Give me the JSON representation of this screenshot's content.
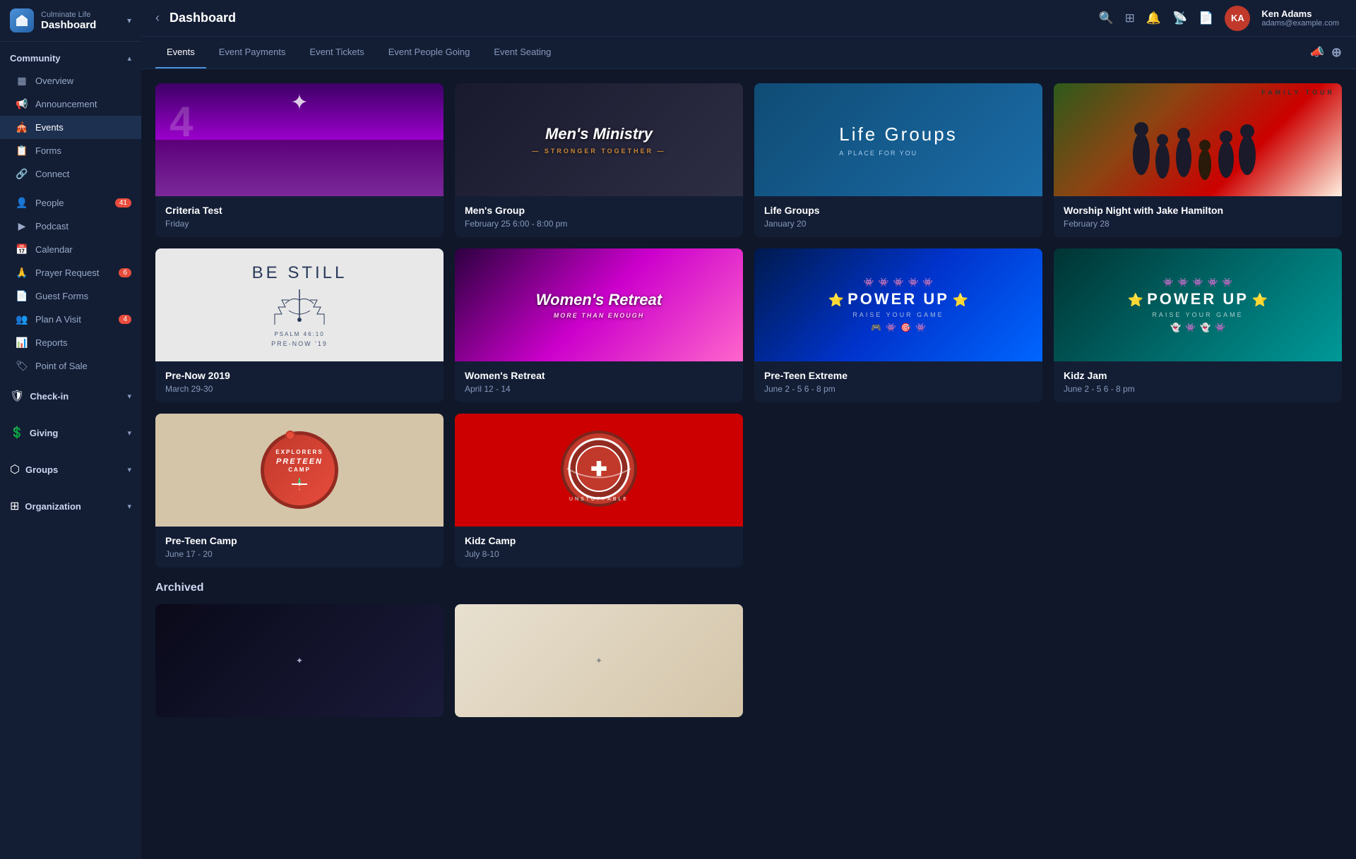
{
  "app": {
    "org_name": "Culminate Life",
    "title": "Dashboard"
  },
  "topbar": {
    "back_label": "‹",
    "title": "Dashboard",
    "user_name": "Ken Adams",
    "user_email": "adams@example.com",
    "user_initials": "KA"
  },
  "sidebar": {
    "logo_subtitle": "Culminate Life",
    "logo_title": "Dashboard",
    "sections": [
      {
        "key": "community",
        "label": "Community",
        "expanded": true,
        "items": [
          {
            "key": "overview",
            "label": "Overview",
            "icon": "▦",
            "badge": null
          },
          {
            "key": "announcement",
            "label": "Announcement",
            "icon": "📢",
            "badge": null
          },
          {
            "key": "events",
            "label": "Events",
            "icon": "🎪",
            "badge": null,
            "active": true
          },
          {
            "key": "forms",
            "label": "Forms",
            "icon": "📋",
            "badge": null
          },
          {
            "key": "connect",
            "label": "Connect",
            "icon": "🔗",
            "badge": null
          }
        ]
      }
    ],
    "standalone_items": [
      {
        "key": "people",
        "label": "People",
        "icon": "👤",
        "badge": "41"
      },
      {
        "key": "podcast",
        "label": "Podcast",
        "icon": "▶",
        "badge": null
      },
      {
        "key": "calendar",
        "label": "Calendar",
        "icon": "📅",
        "badge": null
      },
      {
        "key": "prayer_request",
        "label": "Prayer Request",
        "icon": "🙏",
        "badge": "6"
      },
      {
        "key": "guest_forms",
        "label": "Guest Forms",
        "icon": "📄",
        "badge": null
      },
      {
        "key": "plan_a_visit",
        "label": "Plan A Visit",
        "icon": "👥",
        "badge": "4"
      },
      {
        "key": "reports",
        "label": "Reports",
        "icon": "📊",
        "badge": null
      },
      {
        "key": "point_of_sale",
        "label": "Point of Sale",
        "icon": "🏷",
        "badge": null
      }
    ],
    "collapsible_sections": [
      {
        "key": "checkin",
        "label": "Check-in"
      },
      {
        "key": "giving",
        "label": "Giving"
      },
      {
        "key": "groups",
        "label": "Groups"
      },
      {
        "key": "organization",
        "label": "Organization"
      }
    ]
  },
  "tabs": [
    {
      "key": "events",
      "label": "Events",
      "active": true
    },
    {
      "key": "event_payments",
      "label": "Event Payments",
      "active": false
    },
    {
      "key": "event_tickets",
      "label": "Event Tickets",
      "active": false
    },
    {
      "key": "event_people_going",
      "label": "Event People Going",
      "active": false
    },
    {
      "key": "event_seating",
      "label": "Event Seating",
      "active": false
    }
  ],
  "events": [
    {
      "key": "criteria_test",
      "title": "Criteria Test",
      "date": "Friday",
      "image_type": "concert"
    },
    {
      "key": "mens_group",
      "title": "Men's Group",
      "date": "February 25 6:00 - 8:00 pm",
      "image_type": "mens_ministry"
    },
    {
      "key": "life_groups",
      "title": "Life Groups",
      "date": "January 20",
      "image_type": "life_groups"
    },
    {
      "key": "worship_night",
      "title": "Worship Night with Jake Hamilton",
      "date": "February 28",
      "image_type": "family_tour"
    },
    {
      "key": "pre_now",
      "title": "Pre-Now 2019",
      "date": "March 29-30",
      "image_type": "be_still"
    },
    {
      "key": "womens_retreat",
      "title": "Women's Retreat",
      "date": "April 12 - 14",
      "image_type": "womens_retreat"
    },
    {
      "key": "pre_teen_extreme",
      "title": "Pre-Teen Extreme",
      "date": "June 2 - 5 6 - 8 pm",
      "image_type": "power_up_blue"
    },
    {
      "key": "kidz_jam",
      "title": "Kidz Jam",
      "date": "June 2 - 5 6 - 8 pm",
      "image_type": "power_up_teal"
    },
    {
      "key": "pre_teen_camp",
      "title": "Pre-Teen Camp",
      "date": "June 17 - 20",
      "image_type": "camp"
    },
    {
      "key": "kidz_camp",
      "title": "Kidz Camp",
      "date": "July 8-10",
      "image_type": "shield"
    }
  ],
  "archived": {
    "label": "Archived",
    "events": [
      {
        "key": "archived1",
        "image_type": "archived_dark"
      },
      {
        "key": "archived2",
        "image_type": "archived_light"
      }
    ]
  },
  "icons": {
    "search": "🔍",
    "apps": "⊞",
    "bell": "🔔",
    "broadcast": "📡",
    "doc": "📄",
    "megaphone": "📣",
    "add": "+"
  }
}
